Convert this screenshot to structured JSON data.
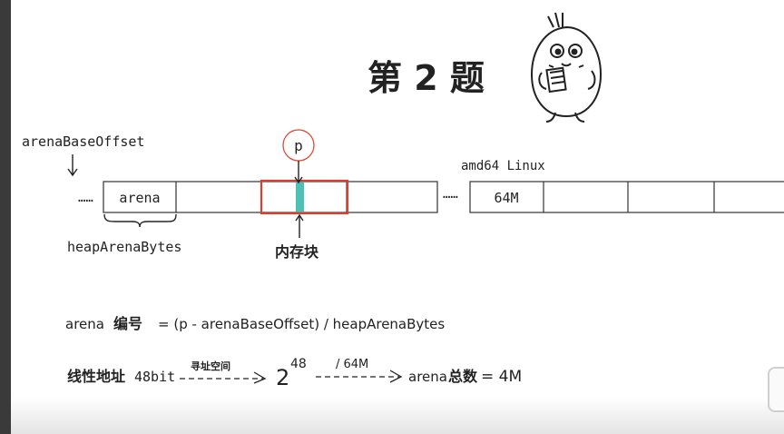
{
  "title": "第 2 题",
  "watermark": "",
  "labels": {
    "arena_base_offset": "arenaBaseOffset",
    "arena_cell": "arena",
    "dots_left": "……",
    "dots_mid": "……",
    "pointer": "p",
    "heap_arena_bytes": "heapArenaBytes",
    "memory_block": "内存块",
    "platform": "amd64 Linux",
    "cell_64m": "64M"
  },
  "formula1": {
    "prefix": "arena",
    "cjk": "编号",
    "rest": "= (p - arenaBaseOffset) / heapArenaBytes"
  },
  "formula2": {
    "cjk_start": "线性地址",
    "bits": "48bit",
    "arrow1_label": "寻址空间",
    "base": "2",
    "exponent": "48",
    "arrow2_label": "/ 64M",
    "result_prefix": "arena",
    "result_cjk": "总数",
    "result_value": "= 4M"
  },
  "colors": {
    "highlight_border": "#d9412e",
    "pointer_block": "#4ec1b5",
    "ink": "#222222"
  }
}
